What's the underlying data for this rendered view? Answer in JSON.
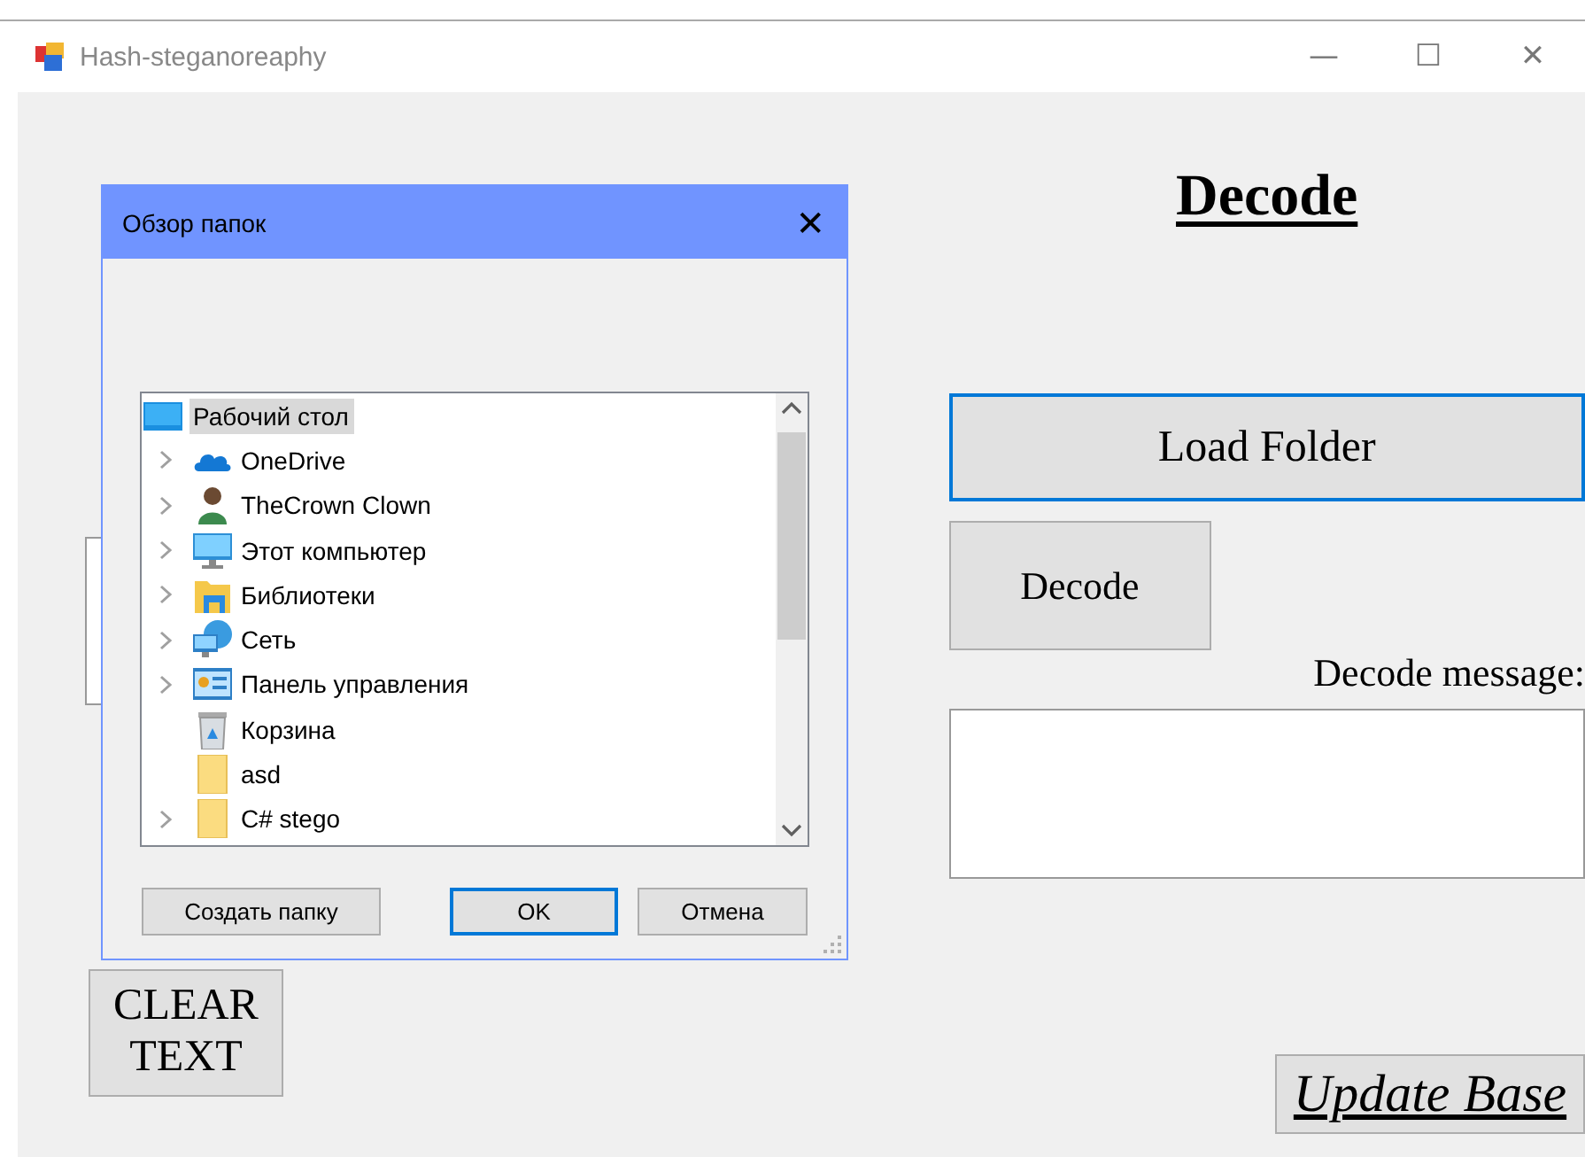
{
  "window": {
    "title": "Hash-steganoreaphy",
    "controls": [
      "—",
      "☐",
      "✕"
    ]
  },
  "encode": {
    "clear_button": "CLEAR\nTEXT"
  },
  "decode": {
    "heading": "Decode",
    "load_button": "Load Folder",
    "load_focused": true,
    "decode_button": "Decode",
    "message_label": "Decode message:",
    "update_button": "Update Base"
  },
  "dialog": {
    "title": "Обзор папок",
    "close": "✕",
    "tree": [
      {
        "label": "Рабочий стол",
        "kind": "desktop",
        "selected": true,
        "children": [
          {
            "label": "OneDrive",
            "kind": "cloud",
            "expandable": true,
            "selected": false
          },
          {
            "label": "TheCrown Clown",
            "kind": "user",
            "expandable": true,
            "selected": false
          },
          {
            "label": "Этот компьютер",
            "kind": "computer",
            "expandable": true,
            "selected": false
          },
          {
            "label": "Библиотеки",
            "kind": "library",
            "expandable": true,
            "selected": false
          },
          {
            "label": "Сеть",
            "kind": "network",
            "expandable": true,
            "selected": false
          },
          {
            "label": "Панель управления",
            "kind": "control-panel",
            "expandable": true,
            "selected": false
          },
          {
            "label": "Корзина",
            "kind": "recycle-bin",
            "expandable": false,
            "selected": false
          },
          {
            "label": "asd",
            "kind": "folder",
            "expandable": false,
            "selected": false
          },
          {
            "label": "C# stego",
            "kind": "folder",
            "expandable": true,
            "selected": false
          }
        ]
      }
    ],
    "buttons": [
      {
        "label": "Создать папку",
        "default": false
      },
      {
        "label": "OK",
        "default": true
      },
      {
        "label": "Отмена",
        "default": false
      }
    ]
  }
}
